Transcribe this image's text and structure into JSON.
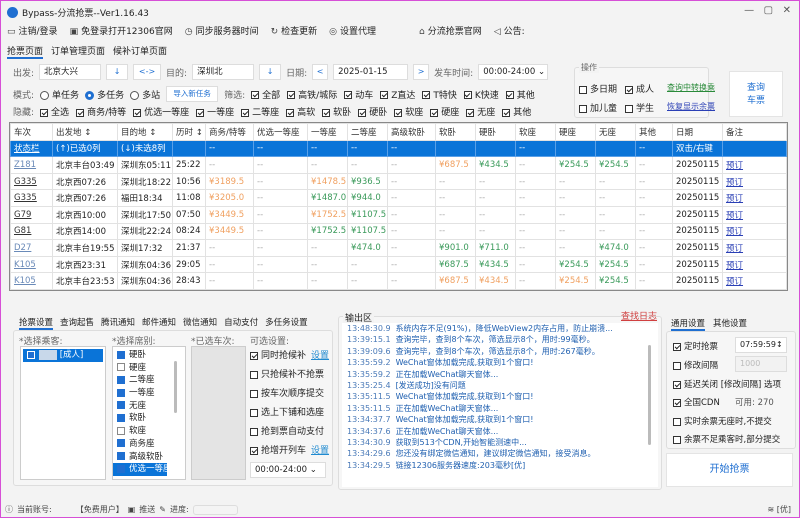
{
  "window": {
    "title": "Bypass-分流抢票--Ver1.16.43"
  },
  "toolbar": {
    "items": [
      {
        "icon": "monitor-icon",
        "label": "注销/登录"
      },
      {
        "icon": "browser-icon",
        "label": "免登录打开12306官网"
      },
      {
        "icon": "clock-icon",
        "label": "同步服务器时间"
      },
      {
        "icon": "refresh-icon",
        "label": "检查更新"
      },
      {
        "icon": "proxy-icon",
        "label": "设置代理"
      }
    ],
    "right": [
      {
        "icon": "home-icon",
        "label": "分流抢票官网"
      },
      {
        "icon": "speaker-icon",
        "label": "公告:"
      }
    ]
  },
  "tabs": [
    "抢票页面",
    "订单管理页面",
    "候补订单页面"
  ],
  "query": {
    "from_label": "出发:",
    "from": "北京大兴",
    "swap": "<->",
    "to_label": "目的:",
    "to": "深圳北",
    "date_label": "日期:",
    "date": "2025-01-15",
    "prev": "<",
    "next": ">",
    "time_label": "发车时间:",
    "time": "00:00-24:00"
  },
  "mode": {
    "label": "模式:",
    "options": [
      "单任务",
      "多任务",
      "多站"
    ],
    "selected": 1,
    "import": "导入新任务",
    "filter_label": "筛选:",
    "filters": [
      "全部",
      "高铁/城际",
      "动车",
      "Z直达",
      "T特快",
      "K快速",
      "其他"
    ]
  },
  "hide": {
    "label": "隐藏:",
    "items": [
      "全选",
      "商务/特等",
      "优选一等座",
      "一等座",
      "二等座",
      "高软",
      "软卧",
      "硬卧",
      "软座",
      "硬座",
      "无座",
      "其他"
    ]
  },
  "ops": {
    "title": "操作",
    "multi_date": "多日期",
    "adult": "成人",
    "child": "加儿童",
    "student": "学生",
    "transfer": "查询中转换乘",
    "restore": "恢复显示余票",
    "query_btn": [
      "查询",
      "车票"
    ]
  },
  "table": {
    "headers": [
      "车次",
      "出发地 ↕",
      "目的地 ↕",
      "历时 ↕",
      "商务/特等",
      "优选一等座",
      "一等座",
      "二等座",
      "高级软卧",
      "软卧",
      "硬卧",
      "软座",
      "硬座",
      "无座",
      "其他",
      "日期",
      "备注"
    ],
    "status_row": [
      "状态栏",
      "(↑)已选0列",
      "(↓)未选8列",
      "",
      "--",
      "--",
      "--",
      "--",
      "--",
      "",
      "",
      "--",
      "",
      "",
      "--",
      "双击/右键",
      ""
    ],
    "rows": [
      [
        "Z181",
        "北京丰台03:49",
        "深圳东05:11",
        "25:22",
        "--",
        "--",
        "--",
        "--",
        "--",
        "¥687.5",
        "¥434.5",
        "--",
        "¥254.5",
        "¥254.5",
        "--",
        "20250115",
        "预订"
      ],
      [
        "G335",
        "北京西07:26",
        "深圳北18:22",
        "10:56",
        "¥3189.5",
        "--",
        "¥1478.5",
        "¥936.5",
        "--",
        "--",
        "--",
        "--",
        "--",
        "--",
        "--",
        "20250115",
        "预订"
      ],
      [
        "G335",
        "北京西07:26",
        "福田18:34",
        "11:08",
        "¥3205.0",
        "--",
        "¥1487.0",
        "¥944.0",
        "--",
        "--",
        "--",
        "--",
        "--",
        "--",
        "--",
        "20250115",
        "预订"
      ],
      [
        "G79",
        "北京西10:00",
        "深圳北17:50",
        "07:50",
        "¥3449.5",
        "--",
        "¥1752.5",
        "¥1107.5",
        "--",
        "--",
        "--",
        "--",
        "--",
        "--",
        "--",
        "20250115",
        "预订"
      ],
      [
        "G81",
        "北京西14:00",
        "深圳北22:24",
        "08:24",
        "¥3449.5",
        "--",
        "¥1752.5",
        "¥1107.5",
        "--",
        "--",
        "--",
        "--",
        "--",
        "--",
        "--",
        "20250115",
        "预订"
      ],
      [
        "D27",
        "北京丰台19:55",
        "深圳17:32",
        "21:37",
        "--",
        "--",
        "--",
        "¥474.0",
        "--",
        "¥901.0",
        "¥711.0",
        "--",
        "--",
        "¥474.0",
        "--",
        "20250115",
        "预订"
      ],
      [
        "K105",
        "北京西23:31",
        "深圳东04:36",
        "29:05",
        "--",
        "--",
        "--",
        "--",
        "--",
        "¥687.5",
        "¥434.5",
        "--",
        "¥254.5",
        "¥254.5",
        "--",
        "20250115",
        "预订"
      ],
      [
        "K105",
        "北京丰台23:53",
        "深圳东04:36",
        "28:43",
        "--",
        "--",
        "--",
        "--",
        "--",
        "¥687.5",
        "¥434.5",
        "--",
        "¥254.5",
        "¥254.5",
        "--",
        "20250115",
        "预订"
      ]
    ],
    "price_colors": [
      {
        "5": "or",
        "6": "gr",
        "8": "gr",
        "9": "gr"
      },
      {
        "0": "or",
        "2": "or",
        "3": "gr"
      },
      {
        "0": "or",
        "2": "gr",
        "3": "gr"
      },
      {
        "0": "or",
        "2": "or",
        "3": "gr"
      },
      {
        "0": "or",
        "2": "gr",
        "3": "gr"
      },
      {
        "3": "gr",
        "5": "gr",
        "6": "gr",
        "9": "gr"
      },
      {
        "5": "gr",
        "6": "gr",
        "8": "gr",
        "9": "gr"
      },
      {
        "5": "or",
        "6": "or",
        "8": "or",
        "9": "gr"
      }
    ]
  },
  "colors": {
    "orange": "#f0a060",
    "green": "#3a9a5a",
    "accent": "#0a74d8"
  },
  "settings_tabs": [
    "抢票设置",
    "查询起售",
    "腾讯通知",
    "邮件通知",
    "微信通知",
    "自动支付",
    "多任务设置"
  ],
  "passengers": {
    "label": "*选择乘客:",
    "items": [
      "[成人]"
    ]
  },
  "seats": {
    "label": "*选择席别:",
    "items": [
      {
        "name": "硬卧",
        "on": true
      },
      {
        "name": "硬座",
        "on": false
      },
      {
        "name": "二等座",
        "on": true
      },
      {
        "name": "一等座",
        "on": true
      },
      {
        "name": "无座",
        "on": true
      },
      {
        "name": "软卧",
        "on": true
      },
      {
        "name": "软座",
        "on": false
      },
      {
        "name": "商务座",
        "on": true
      },
      {
        "name": "高级软卧",
        "on": true
      },
      {
        "name": "优选一等座",
        "on": true
      }
    ]
  },
  "trains": {
    "label": "*已选车次:"
  },
  "options": {
    "label": "可选设置:",
    "items": [
      {
        "name": "同时抢候补",
        "on": true,
        "link": "设置"
      },
      {
        "name": "只抢候补不抢票",
        "on": false
      },
      {
        "name": "按车次顺序提交",
        "on": false
      },
      {
        "name": "选上下铺和选座",
        "on": false
      },
      {
        "name": "抢到票自动支付",
        "on": false
      },
      {
        "name": "抢增开列车",
        "on": true,
        "link": "设置"
      }
    ],
    "time": "00:00-24:00"
  },
  "output": {
    "title": "输出区",
    "find_log": "查找日志",
    "lines": [
      [
        "13:48:30.9",
        "系统内存不足(91%)，降低WebView2内存占用，防止崩溃..."
      ],
      [
        "13:39:15.1",
        "查询完毕，查到8个车次，筛选显示8个，用时:99毫秒。"
      ],
      [
        "13:39:09.6",
        "查询完毕，查到8个车次，筛选显示8个，用时:267毫秒。"
      ],
      [
        "13:35:59.2",
        "WeChat窗体加载完成,获取到1个窗口!"
      ],
      [
        "13:35:59.2",
        "正在加载WeChat聊天窗体..."
      ],
      [
        "13:35:25.4",
        "[发送成功]没有问题"
      ],
      [
        "13:35:11.5",
        "WeChat窗体加载完成,获取到1个窗口!"
      ],
      [
        "13:35:11.5",
        "正在加载WeChat聊天窗体..."
      ],
      [
        "13:34:37.7",
        "WeChat窗体加载完成,获取到1个窗口!"
      ],
      [
        "13:34:37.6",
        "正在加载WeChat聊天窗体..."
      ],
      [
        "13:34:30.9",
        "获取到513个CDN,开始智能测速中..."
      ],
      [
        "13:34:29.6",
        "您还没有绑定微信通知，建议绑定微信通知，接受消息。"
      ],
      [
        "13:34:29.5",
        "链接12306服务器速度:203毫秒[优]"
      ]
    ]
  },
  "general": {
    "tabs": [
      "通用设置",
      "其他设置"
    ],
    "timed": "定时抢票",
    "timed_value": "07:59:59",
    "interval": "修改间隔",
    "interval_value": "1000",
    "delay": "延迟关闭 [修改间隔] 选项",
    "cdn": "全国CDN",
    "cdn_avail": "可用: 270",
    "opt1": "实时余票无座时,不提交",
    "opt2": "余票不足乘客时,部分提交",
    "start": "开始抢票"
  },
  "status": {
    "account_label": "当前账号:",
    "account": "【免费用户】",
    "push": "推送",
    "progress_label": "进度:",
    "progress": 0,
    "net": "[优]"
  }
}
